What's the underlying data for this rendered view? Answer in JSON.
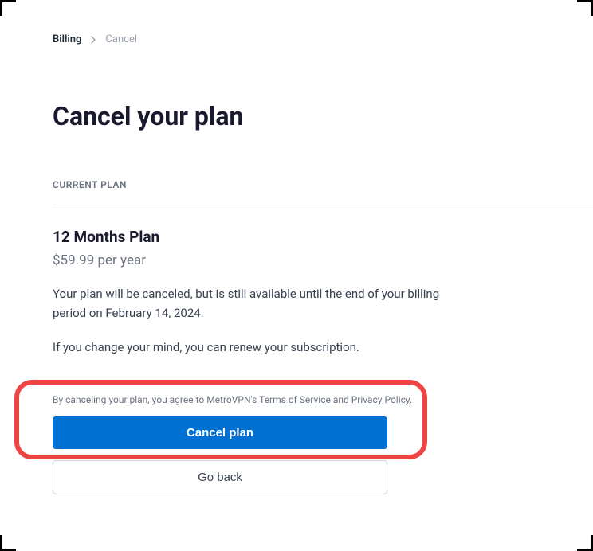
{
  "breadcrumb": {
    "parent": "Billing",
    "current": "Cancel"
  },
  "page": {
    "title": "Cancel your plan",
    "section_label": "CURRENT PLAN"
  },
  "plan": {
    "name": "12 Months Plan",
    "price": "$59.99 per year",
    "description": "Your plan will be canceled, but is still available until the end of your billing period on February 14, 2024.",
    "note": "If you change your mind, you can renew your subscription."
  },
  "agreement": {
    "prefix": "By canceling your plan, you agree to MetroVPN's ",
    "tos": "Terms of Service",
    "and": " and ",
    "privacy": "Privacy Policy",
    "suffix": "."
  },
  "buttons": {
    "cancel": "Cancel plan",
    "goback": "Go back"
  }
}
